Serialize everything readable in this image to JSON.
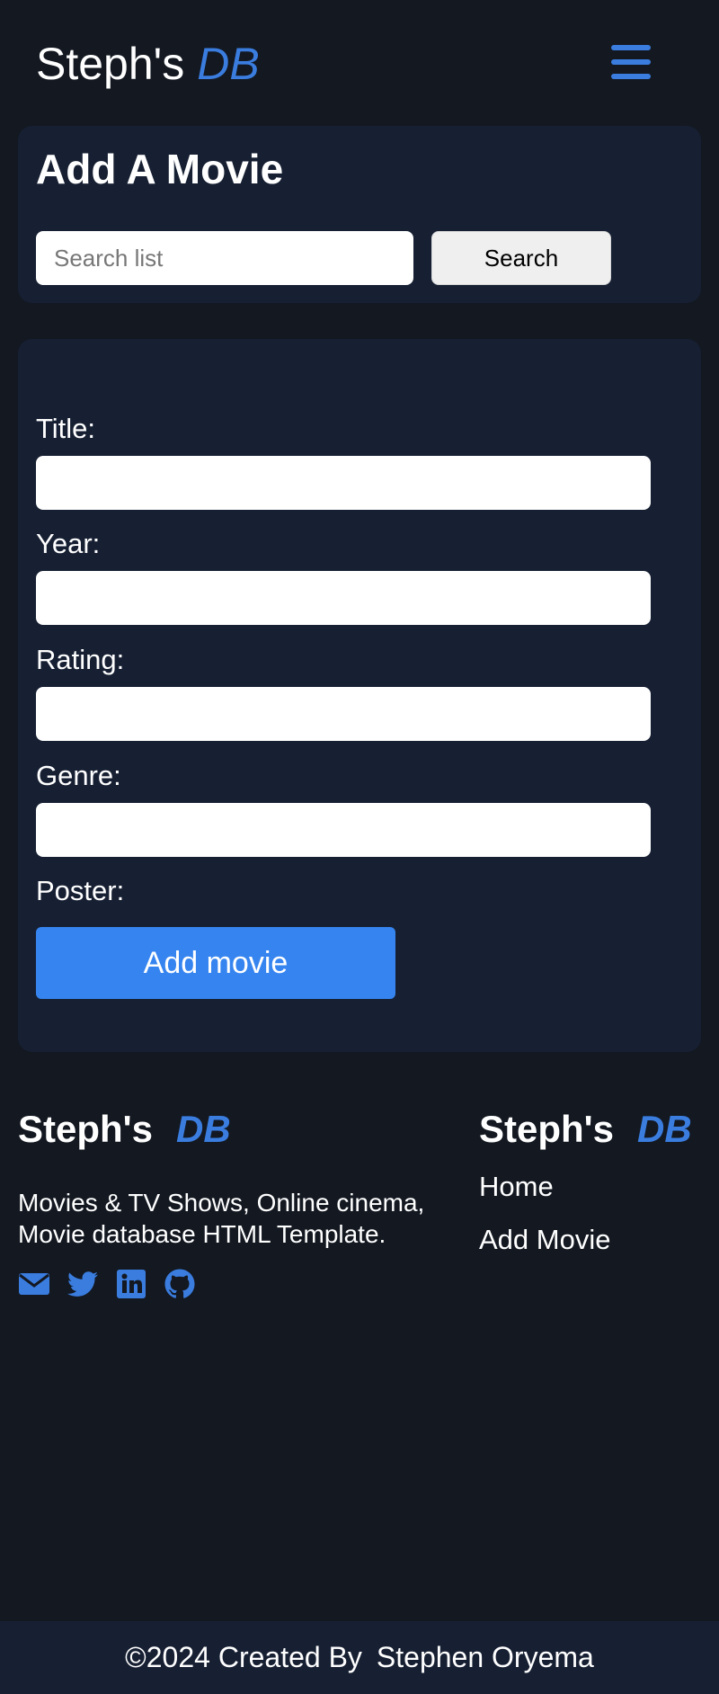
{
  "header": {
    "brand_main": "Steph's",
    "brand_accent": "DB",
    "menu_icon": "hamburger-icon"
  },
  "search": {
    "heading": "Add A Movie",
    "placeholder": "Search list",
    "button_label": "Search"
  },
  "form": {
    "fields": [
      {
        "label": "Title:",
        "value": ""
      },
      {
        "label": "Year:",
        "value": ""
      },
      {
        "label": "Rating:",
        "value": ""
      },
      {
        "label": "Genre:",
        "value": ""
      },
      {
        "label": "Poster:"
      }
    ],
    "submit_label": "Add movie"
  },
  "footer": {
    "brand_main": "Steph's",
    "brand_accent": "DB",
    "description": "Movies & TV Shows, Online cinema, Movie database HTML Template.",
    "socials": [
      "envelope-icon",
      "twitter-icon",
      "linkedin-icon",
      "github-icon"
    ],
    "nav_brand_main": "Steph's",
    "nav_brand_accent": "DB",
    "nav_links": [
      "Home",
      "Add Movie"
    ],
    "copyright": "©2024 Created By",
    "author": "Stephen Oryema"
  },
  "colors": {
    "background": "#131821",
    "card": "#172033",
    "accent": "#3a7ddf",
    "button": "#3584f0"
  }
}
